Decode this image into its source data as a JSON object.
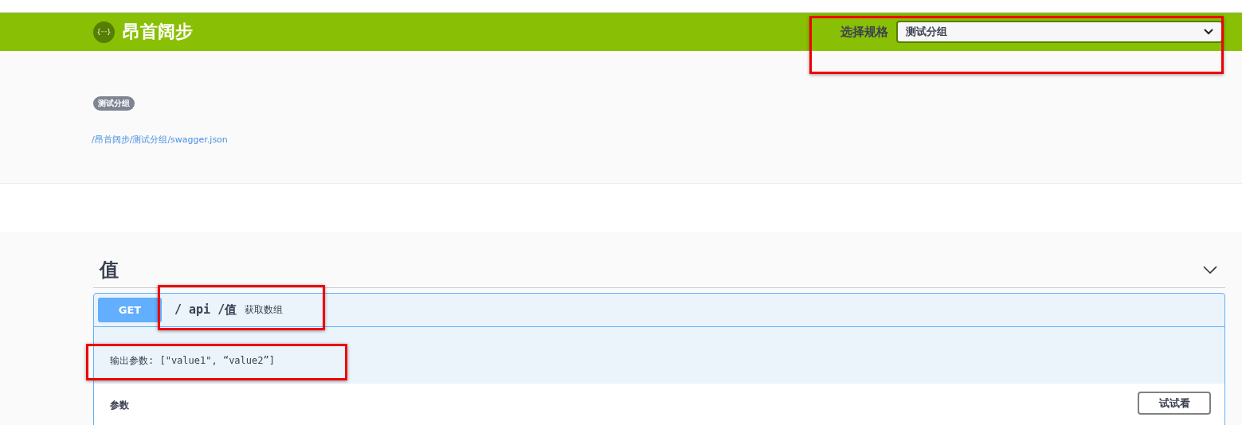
{
  "topbar": {
    "logo_glyph": "{···}",
    "title": "昂首阔步",
    "spec_label": "选择规格",
    "spec_value": "测试分组",
    "spec_highlighted": true
  },
  "info": {
    "badge": "测试分组",
    "url": "/昂首阔步/测试分组/swagger.json"
  },
  "section": {
    "title": "值",
    "expanded": true,
    "operation": {
      "method": "GET",
      "path": "/ api /值",
      "summary": "获取数组",
      "path_highlighted": true,
      "note": "输出参数: [\"value1\", “value2”]",
      "note_highlighted": true,
      "params_label": "参数",
      "try_button": "试试看"
    }
  }
}
